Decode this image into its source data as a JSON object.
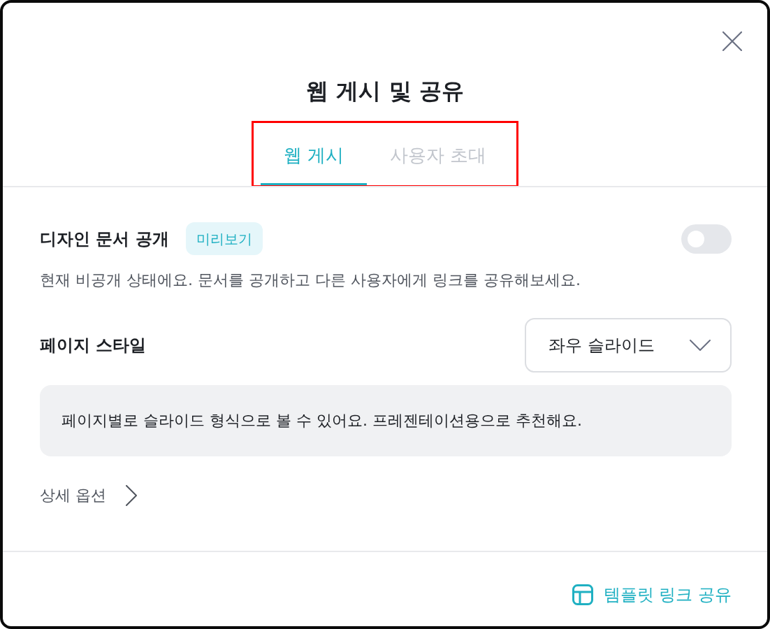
{
  "dialog": {
    "title": "웹 게시 및 공유"
  },
  "tabs": [
    {
      "label": "웹 게시",
      "selected": true
    },
    {
      "label": "사용자 초대",
      "selected": false
    }
  ],
  "tabs_highlighted": true,
  "publish": {
    "label": "디자인 문서 공개",
    "badge": "미리보기",
    "on": false,
    "description": "현재 비공개 상태에요. 문서를 공개하고 다른 사용자에게 링크를 공유해보세요."
  },
  "page_style": {
    "label": "페이지 스타일",
    "value": "좌우 슬라이드",
    "info": "페이지별로 슬라이드 형식으로 볼 수 있어요. 프레젠테이션용으로 추천해요."
  },
  "details_link": "상세 옵션",
  "footer": {
    "link": "템플릿 링크 공유"
  }
}
